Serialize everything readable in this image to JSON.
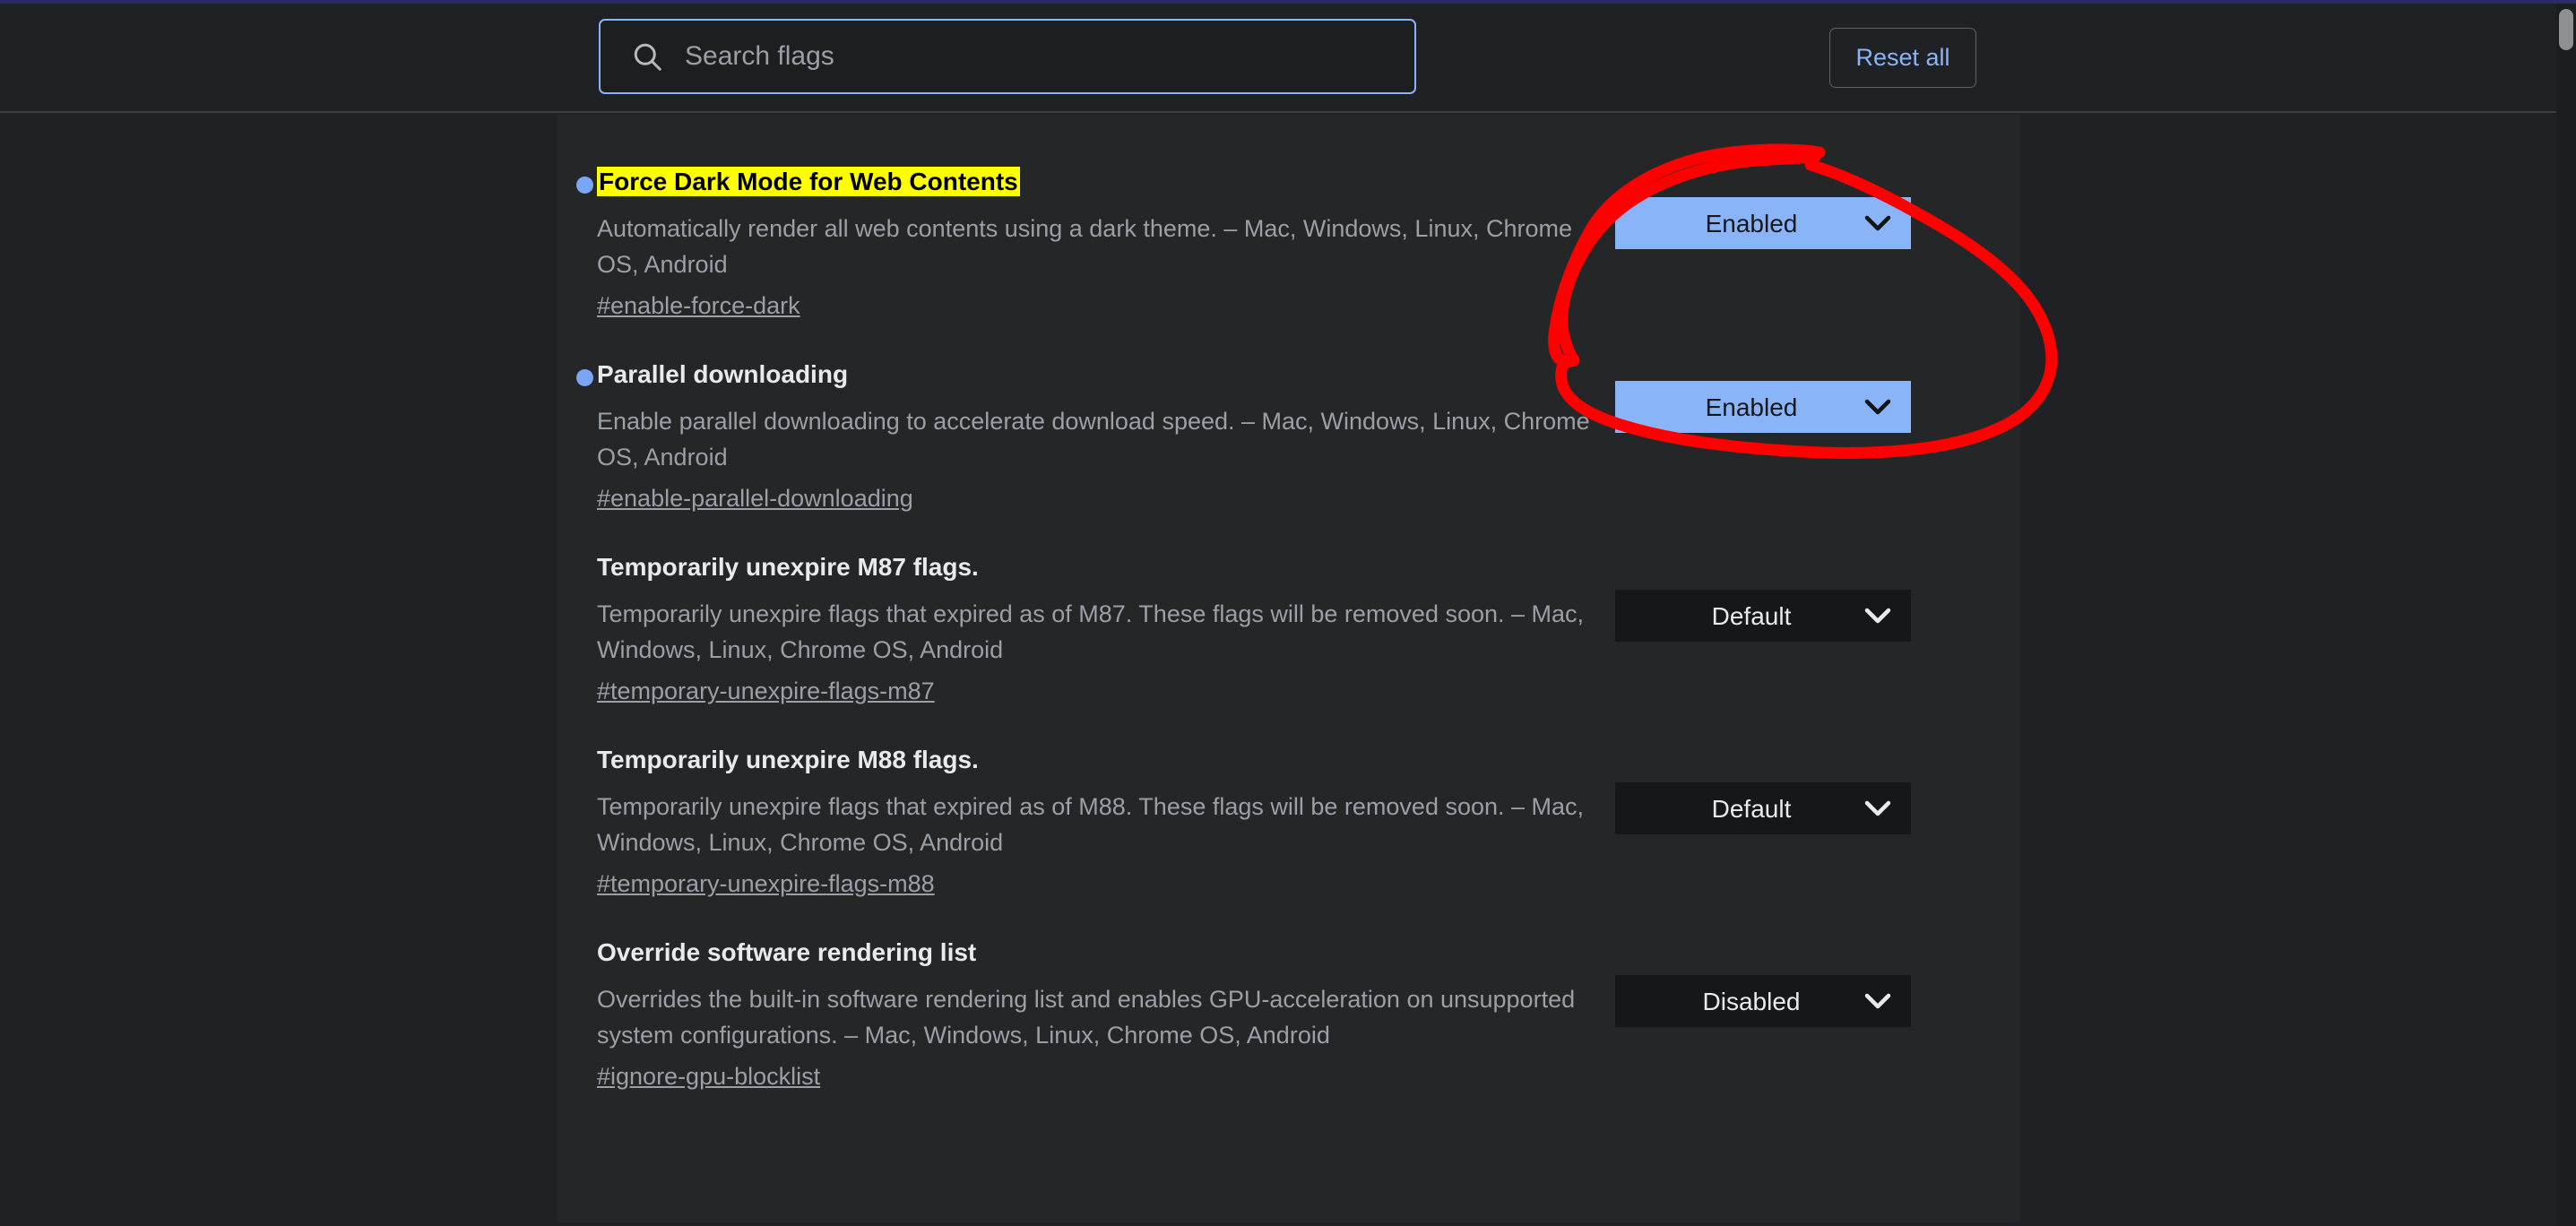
{
  "window": {
    "background_color": "#202124",
    "card_color": "#252628",
    "accent_color": "#8ab4f8",
    "highlight_color": "#ffff00",
    "annotation_color": "#ff0000"
  },
  "header": {
    "search": {
      "icon": "search-icon",
      "placeholder": "Search flags",
      "value": ""
    },
    "reset_all_label": "Reset all"
  },
  "flags": [
    {
      "has_dot": true,
      "highlighted": true,
      "title": "Force Dark Mode for Web Contents",
      "description": "Automatically render all web contents using a dark theme. – Mac, Windows, Linux, Chrome OS, Android",
      "id_link": "#enable-force-dark",
      "select": {
        "value": "Enabled",
        "state": "on",
        "options": [
          "Default",
          "Enabled",
          "Disabled"
        ]
      }
    },
    {
      "has_dot": true,
      "highlighted": false,
      "title": "Parallel downloading",
      "description": "Enable parallel downloading to accelerate download speed. – Mac, Windows, Linux, Chrome OS, Android",
      "id_link": "#enable-parallel-downloading",
      "select": {
        "value": "Enabled",
        "state": "on",
        "options": [
          "Default",
          "Enabled",
          "Disabled"
        ]
      }
    },
    {
      "has_dot": false,
      "highlighted": false,
      "title": "Temporarily unexpire M87 flags.",
      "description": "Temporarily unexpire flags that expired as of M87. These flags will be removed soon. – Mac, Windows, Linux, Chrome OS, Android",
      "id_link": "#temporary-unexpire-flags-m87",
      "select": {
        "value": "Default",
        "state": "neutral",
        "options": [
          "Default",
          "Enabled",
          "Disabled"
        ]
      }
    },
    {
      "has_dot": false,
      "highlighted": false,
      "title": "Temporarily unexpire M88 flags.",
      "description": "Temporarily unexpire flags that expired as of M88. These flags will be removed soon. – Mac, Windows, Linux, Chrome OS, Android",
      "id_link": "#temporary-unexpire-flags-m88",
      "select": {
        "value": "Default",
        "state": "neutral",
        "options": [
          "Default",
          "Enabled",
          "Disabled"
        ]
      }
    },
    {
      "has_dot": false,
      "highlighted": false,
      "title": "Override software rendering list",
      "description": "Overrides the built-in software rendering list and enables GPU-acceleration on unsupported system configurations. – Mac, Windows, Linux, Chrome OS, Android",
      "id_link": "#ignore-gpu-blocklist",
      "select": {
        "value": "Disabled",
        "state": "neutral",
        "options": [
          "Default",
          "Enabled",
          "Disabled"
        ]
      }
    }
  ],
  "annotation": {
    "shape": "hand-drawn-red-ellipse",
    "target": "first flag Enabled dropdown"
  },
  "scrollbar": {
    "orientation": "vertical",
    "thumb_position": "top"
  }
}
